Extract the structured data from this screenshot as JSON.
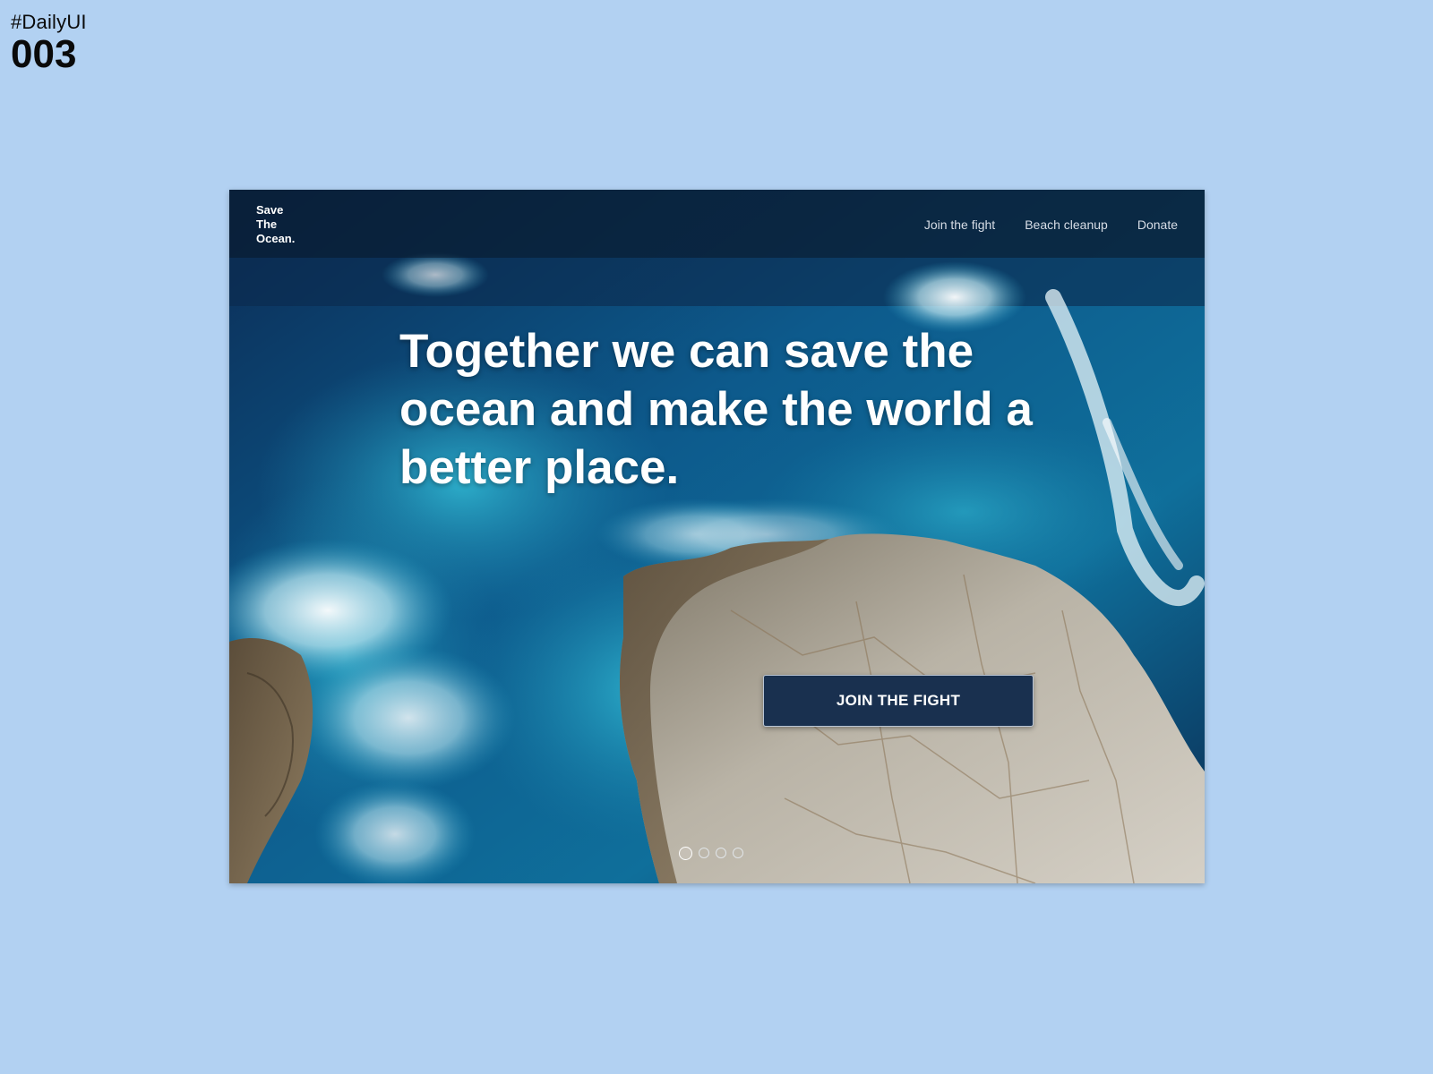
{
  "page": {
    "tag": "#DailyUI",
    "number": "003"
  },
  "nav": {
    "brand": [
      "Save",
      "The",
      "Ocean."
    ],
    "links": [
      "Join the fight",
      "Beach cleanup",
      "Donate"
    ]
  },
  "hero": {
    "headline": "Together we can save the ocean and make the world a better place.",
    "cta_label": "JOIN THE FIGHT",
    "background": "aerial-ocean-rocks-photo"
  },
  "carousel": {
    "dot_count": 4,
    "active_index": 0
  },
  "colors": {
    "page_background": "#b2d1f2",
    "cta_background": "#19304f",
    "navbar_overlay": "#0a1828"
  }
}
